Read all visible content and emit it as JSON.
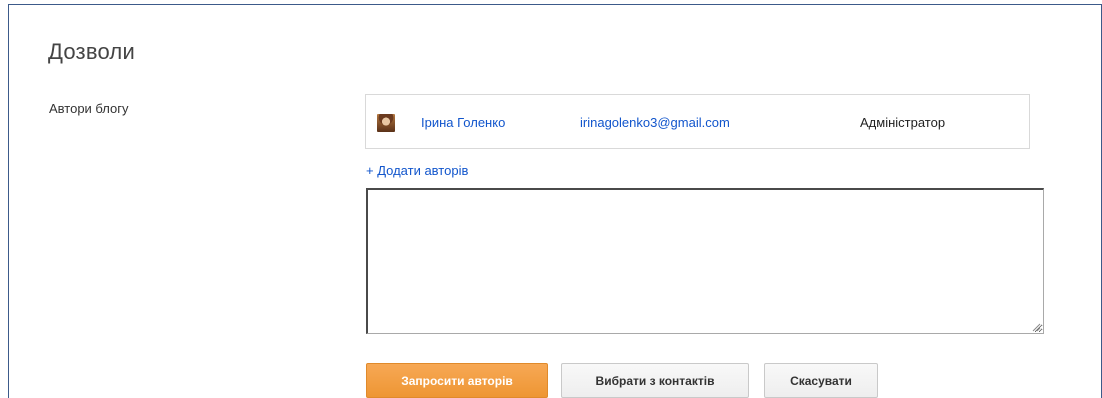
{
  "page": {
    "title": "Дозволи"
  },
  "authors_section": {
    "label": "Автори блогу",
    "authors": [
      {
        "name": "Ірина Голенко",
        "email": "irinagolenko3@gmail.com",
        "role": "Адміністратор",
        "avatar": "user-avatar-photo"
      }
    ],
    "add_authors_label": "+ Додати авторів",
    "invite_textarea_value": ""
  },
  "actions": {
    "invite_label": "Запросити авторів",
    "choose_contacts_label": "Вибрати з контактів",
    "cancel_label": "Скасувати"
  },
  "colors": {
    "link": "#1155cc",
    "primary_button": "#f09a3e",
    "frame_border": "#3c5a8a"
  }
}
